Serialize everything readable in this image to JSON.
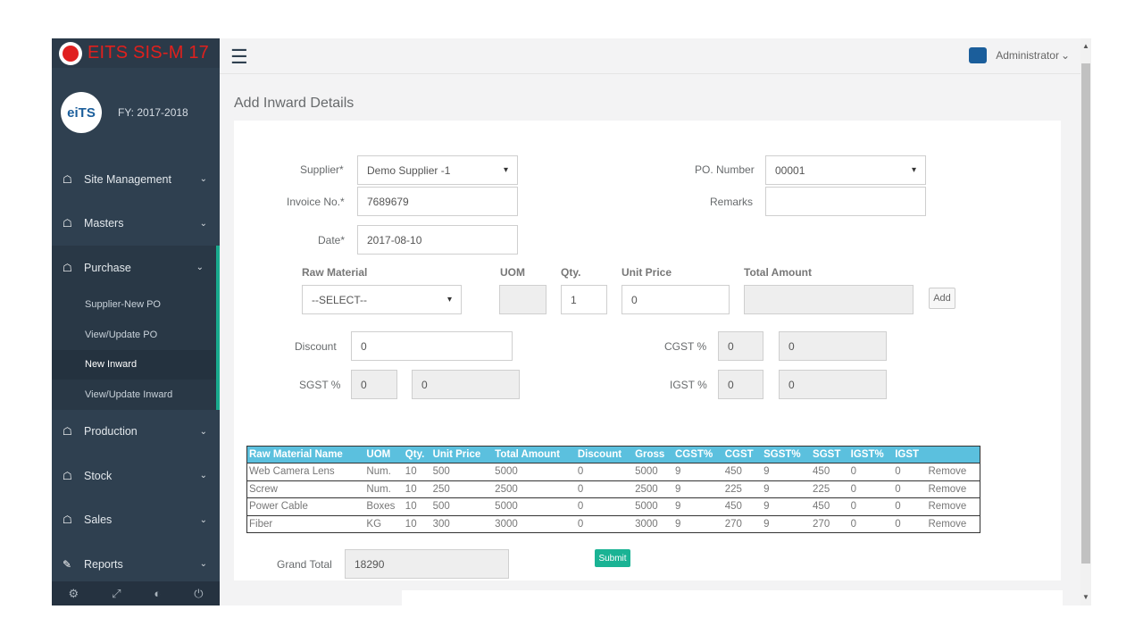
{
  "app": {
    "brand": "EITS SIS-M 17",
    "fiscal_year": "FY: 2017-2018",
    "avatar_text": "eiTS"
  },
  "topbar": {
    "user": "Administrator",
    "user_caret": "⌄",
    "menu_icon": "☰"
  },
  "sidebar": {
    "items": [
      {
        "label": "Site Management",
        "icon": "home-icon"
      },
      {
        "label": "Masters",
        "icon": "home-icon"
      },
      {
        "label": "Purchase",
        "icon": "home-icon"
      },
      {
        "label": "Production",
        "icon": "home-icon"
      },
      {
        "label": "Stock",
        "icon": "home-icon"
      },
      {
        "label": "Sales",
        "icon": "home-icon"
      },
      {
        "label": "Reports",
        "icon": "edit-icon"
      }
    ],
    "purchase_sub": [
      "Supplier-New PO",
      "View/Update PO",
      "New Inward",
      "View/Update Inward"
    ],
    "footer_icons": [
      "gear-icon",
      "expand-icon",
      "palette-icon",
      "power-icon"
    ]
  },
  "page": {
    "title": "Add Inward Details"
  },
  "form": {
    "supplier_label": "Supplier*",
    "supplier_value": "Demo Supplier -1",
    "po_label": "PO. Number",
    "po_value": "00001",
    "invoice_label": "Invoice No.*",
    "invoice_value": "7689679",
    "remarks_label": "Remarks",
    "remarks_value": "",
    "date_label": "Date*",
    "date_value": "2017-08-10",
    "raw_material_label": "Raw Material",
    "raw_material_value": "--SELECT--",
    "uom_label": "UOM",
    "uom_value": "",
    "qty_label": "Qty.",
    "qty_value": "1",
    "unit_price_label": "Unit Price",
    "unit_price_value": "0",
    "total_amount_label": "Total Amount",
    "total_amount_value": "",
    "add_label": "Add",
    "discount_label": "Discount",
    "discount_value": "0",
    "cgst_label": "CGST %",
    "cgst_pct": "0",
    "cgst_amt": "0",
    "sgst_label": "SGST %",
    "sgst_pct": "0",
    "sgst_amt": "0",
    "igst_label": "IGST %",
    "igst_pct": "0",
    "igst_amt": "0",
    "grand_total_label": "Grand Total",
    "grand_total_value": "18290",
    "submit_label": "Submit"
  },
  "table": {
    "headers": [
      "Raw Material Name",
      "UOM",
      "Qty.",
      "Unit Price",
      "Total Amount",
      "Discount",
      "Gross",
      "CGST%",
      "CGST",
      "SGST%",
      "SGST",
      "IGST%",
      "IGST",
      ""
    ],
    "rows": [
      [
        "Web Camera Lens",
        "Num.",
        "10",
        "500",
        "5000",
        "0",
        "5000",
        "9",
        "450",
        "9",
        "450",
        "0",
        "0",
        "Remove"
      ],
      [
        "Screw",
        "Num.",
        "10",
        "250",
        "2500",
        "0",
        "2500",
        "9",
        "225",
        "9",
        "225",
        "0",
        "0",
        "Remove"
      ],
      [
        "Power Cable",
        "Boxes",
        "10",
        "500",
        "5000",
        "0",
        "5000",
        "9",
        "450",
        "9",
        "450",
        "0",
        "0",
        "Remove"
      ],
      [
        "Fiber",
        "KG",
        "10",
        "300",
        "3000",
        "0",
        "3000",
        "9",
        "270",
        "9",
        "270",
        "0",
        "0",
        "Remove"
      ]
    ]
  },
  "colors": {
    "sidebar": "#2f4050",
    "accent": "#19aa8d",
    "brand": "#e0201d",
    "table_header": "#5bc0de",
    "submit": "#1ab394"
  }
}
